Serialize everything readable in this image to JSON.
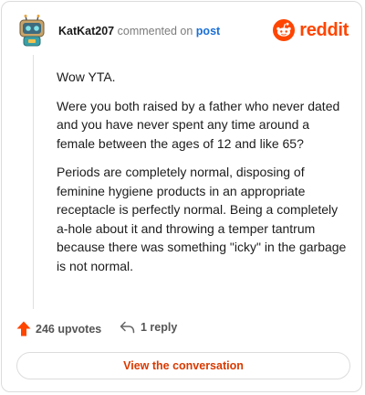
{
  "header": {
    "username": "KatKat207",
    "action_text": "commented on",
    "post_link": "post",
    "brand": "reddit"
  },
  "comment": {
    "paragraphs": [
      "Wow YTA.",
      "Were you both raised by a father who never dated and you have never spent any time around a female between the ages of 12 and like 65?",
      "Periods are completely normal, disposing of feminine hygiene products in an appropriate receptacle is perfectly normal. Being a completely a-hole about it and throwing a temper tantrum because there was something \"icky\" in the garbage is not normal."
    ]
  },
  "footer": {
    "upvotes": "246 upvotes",
    "replies": "1 reply",
    "view_button": "View the conversation"
  },
  "colors": {
    "brand": "#ff4500",
    "link": "#1a6fd6",
    "button_text": "#d93a00"
  },
  "icons": {
    "avatar": "robot-avatar",
    "logo": "reddit-snoo-icon",
    "upvote": "upvote-arrow-icon",
    "reply": "reply-arrow-icon"
  }
}
